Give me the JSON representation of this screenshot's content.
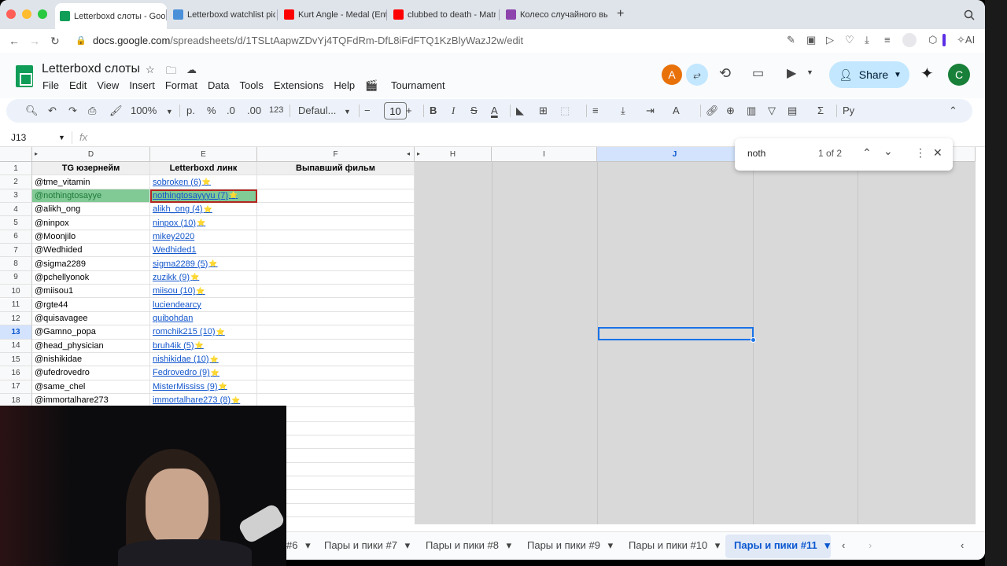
{
  "browser": {
    "tabs": [
      {
        "title": "Letterboxd слоты - Goog",
        "favicon": "sheets-icon",
        "color": "#0f9d58",
        "active": true
      },
      {
        "title": "Letterboxd watchlist pick",
        "favicon": "picker-icon",
        "color": "#4a90d9",
        "active": false
      },
      {
        "title": "Kurt Angle - Medal (Entr",
        "favicon": "youtube-icon",
        "color": "#ff0000",
        "active": false
      },
      {
        "title": "clubbed to death - Matri",
        "favicon": "youtube-icon",
        "color": "#ff0000",
        "active": false
      },
      {
        "title": "Колесо случайного выб",
        "favicon": "wheel-icon",
        "color": "#8e44ad",
        "active": false
      }
    ],
    "new_tab_label": "+",
    "url_domain": "docs.google.com",
    "url_path": "/spreadsheets/d/1TSLtAapwZDvYj4TQFdRm-DfL8iFdFTQ1KzBlyWazJ2w/edit",
    "ai_label": "AI"
  },
  "doc": {
    "title": "Letterboxd слоты",
    "menu": [
      "File",
      "Edit",
      "View",
      "Insert",
      "Format",
      "Data",
      "Tools",
      "Extensions",
      "Help",
      "Tournament"
    ],
    "share_label": "Share",
    "avatar_a": "A",
    "avatar_c": "C",
    "avatar_a_color": "#e8710a",
    "avatar_c_color": "#188038"
  },
  "toolbar": {
    "zoom": "100%",
    "currency": "p.",
    "percent": "%",
    "dec_decrease": ".0",
    "dec_increase": ".00",
    "format_123": "123",
    "font": "Defaul...",
    "font_size": "10",
    "bold": "B",
    "italic": "I"
  },
  "formula": {
    "namebox": "J13",
    "fx": "fx"
  },
  "find": {
    "query": "noth",
    "count": "1 of 2"
  },
  "columns": {
    "D": "D",
    "E": "E",
    "F": "F",
    "H": "H",
    "I": "I",
    "J": "J"
  },
  "sheet": {
    "headers": {
      "d": "TG юзернейм",
      "e": "Letterboxd линк",
      "f": "Выпавший фильм"
    },
    "rows": [
      {
        "n": "1"
      },
      {
        "n": "2",
        "d": "@tme_vitamin",
        "e": "sobroken (6)",
        "star": true
      },
      {
        "n": "3",
        "d": "@nothingtosayye",
        "e": "nothingtosayyyu (7)",
        "star": true,
        "hl": true
      },
      {
        "n": "4",
        "d": "@alikh_ong",
        "e": "alikh_ong (4)",
        "star": true
      },
      {
        "n": "5",
        "d": "@ninpox",
        "e": "ninpox (10)",
        "star": true
      },
      {
        "n": "6",
        "d": "@Moonjilo",
        "e": "mikey2020",
        "star": false
      },
      {
        "n": "7",
        "d": "@Wedhided",
        "e": "Wedhided1",
        "star": false
      },
      {
        "n": "8",
        "d": "@sigma2289",
        "e": "sigma2289 (5)",
        "star": true
      },
      {
        "n": "9",
        "d": "@pchellyonok",
        "e": "zuzikk (9)",
        "star": true
      },
      {
        "n": "10",
        "d": "@miisou1",
        "e": "miisou (10)",
        "star": true
      },
      {
        "n": "11",
        "d": "@rgte44",
        "e": "luciendearcy",
        "star": false
      },
      {
        "n": "12",
        "d": "@quisavagee",
        "e": "quibohdan",
        "star": false
      },
      {
        "n": "13",
        "d": "@Gamno_popa",
        "e": "romchik215 (10)",
        "star": true
      },
      {
        "n": "14",
        "d": "@head_physician",
        "e": "bruh4ik (5)",
        "star": true
      },
      {
        "n": "15",
        "d": "@nishikidae",
        "e": "nishikidae (10)",
        "star": true
      },
      {
        "n": "16",
        "d": "@ufedrovedro",
        "e": "Fedrovedro (9)",
        "star": true
      },
      {
        "n": "17",
        "d": "@same_chel",
        "e": "MisterMississ (9)",
        "star": true
      },
      {
        "n": "18",
        "d": "@immortalhare273",
        "e": "immortalhare273 (8)",
        "star": true
      }
    ],
    "star_glyph": "⭐"
  },
  "sheet_tabs": [
    {
      "label": "#6",
      "active": false
    },
    {
      "label": "Пары и пики #7",
      "active": false
    },
    {
      "label": "Пары и пики #8",
      "active": false
    },
    {
      "label": "Пары и пики #9",
      "active": false
    },
    {
      "label": "Пары и пики #10",
      "active": false
    },
    {
      "label": "Пары и пики #11",
      "active": true
    }
  ]
}
